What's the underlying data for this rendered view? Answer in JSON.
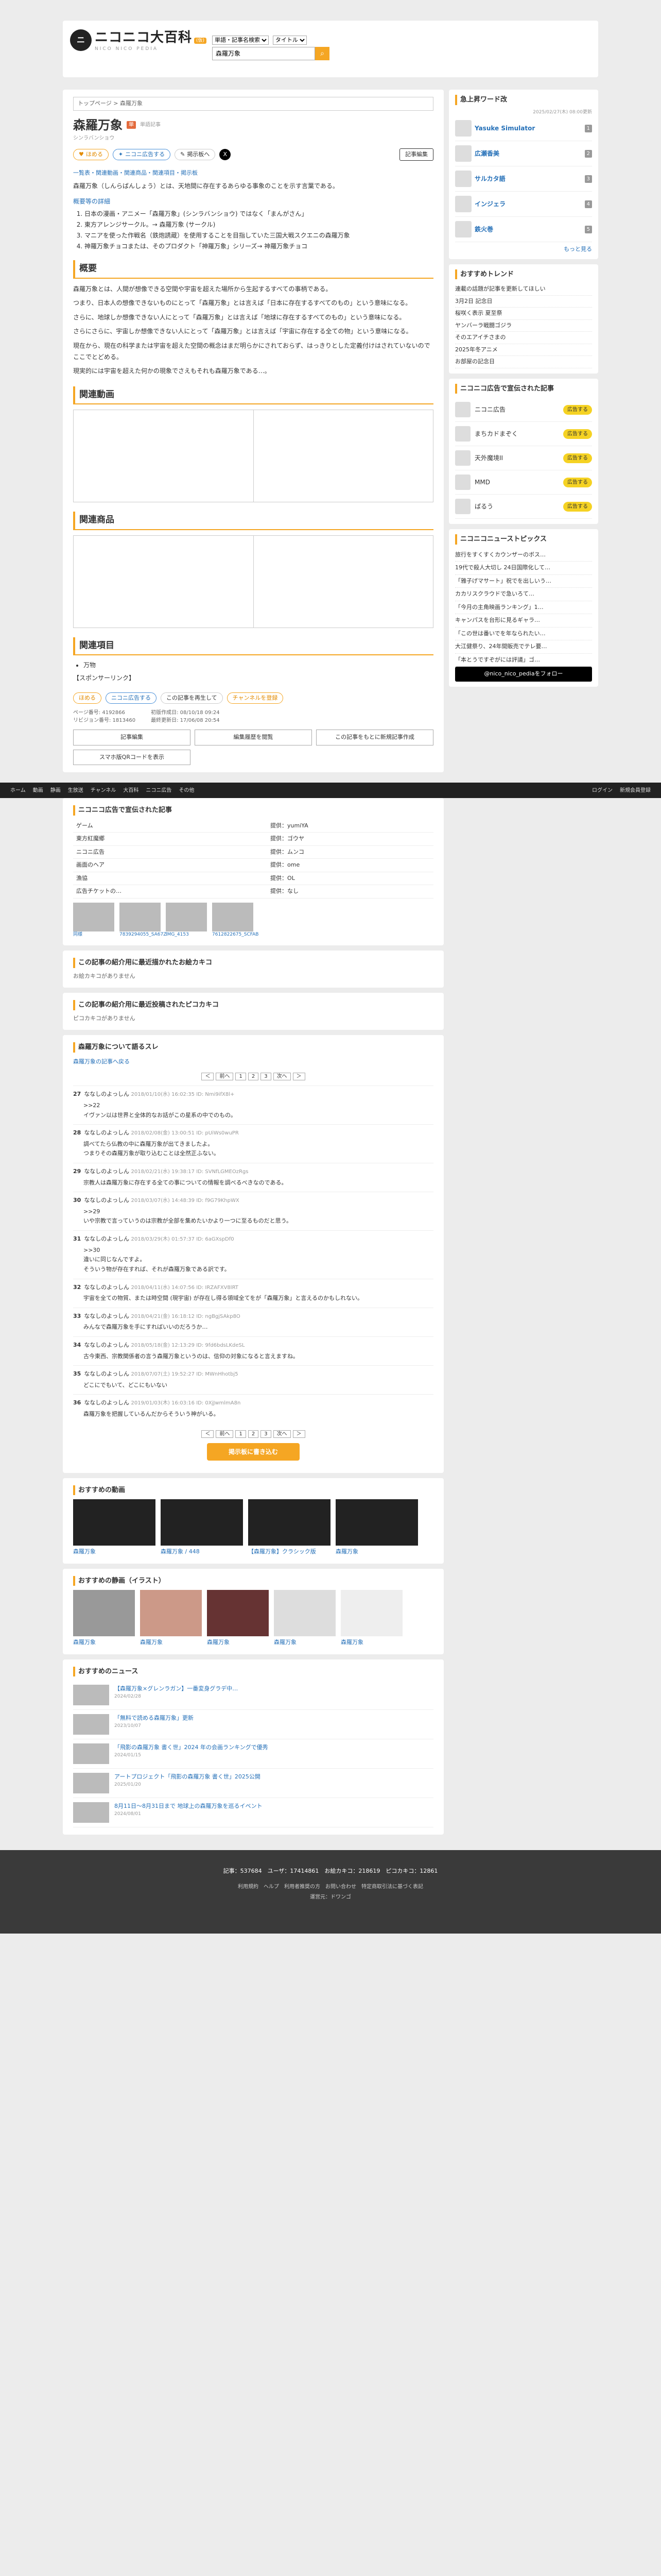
{
  "header": {
    "logo_text": "ニコニコ大百科",
    "logo_sub": "NICO NICO PEDIA",
    "logo_badge": "(仮)",
    "search_scope": "単語・記事名検索",
    "search_type": "タイトル",
    "search_value": "森羅万象"
  },
  "article": {
    "breadcrumb": "トップページ > 森羅万象",
    "title": "森羅万象",
    "badge": "単",
    "count": "単語記事",
    "reading": "シンラバンショウ",
    "like_label": "ほめる",
    "nico_label": "ニコニ広告する",
    "comment_label": "掲示板へ",
    "edit_label": "記事編集",
    "tabs": "一覧表・関連動画・関連商品・関連項目・掲示板",
    "intro": "森羅万象（しんらばんしょう）とは、天地間に存在するあらゆる事象のことを示す言葉である。",
    "toc_title": "概要等の詳細",
    "toc": [
      "日本の漫画・アニメー「森羅万象」(シンラバンショウ) ではなく「まんがさん」",
      "東方アレンジサークル。→ 森羅万象 (サークル)",
      "マニアを使った作戦名（鉄炮誘蔵）を使用することを目指していた三国大戦スクエニの森羅万象",
      "神羅万象チョコまたは、そのプロダクト「神羅万象」シリーズ→ 神羅万象チョコ"
    ],
    "s1": "概要",
    "p1": "森羅万象とは、人間が想像できる空間や宇宙を超えた場所から生起するすべての事柄である。",
    "p2": "つまり、日本人の想像できないものにとって「森羅万象」とは言えば「日本に存在するすべてのもの」という意味になる。",
    "p3": "さらに、地球しか想像できない人にとって「森羅万象」とは言えば「地球に存在するすべてのもの」という意味になる。",
    "p4": "さらにさらに、宇宙しか想像できない人にとって「森羅万象」とは言えば「宇宙に存在する全ての物」という意味になる。",
    "p5": "現在から、現在の科学または宇宙を超えた空間の概念はまだ明らかにされておらず、はっきりとした定義付けはされていないのでここでとどめる。",
    "p6": "現実的には宇宙を超えた何かの現象でさえもそれも森羅万象である…。",
    "s2": "関連動画",
    "s3": "関連商品",
    "s4": "関連項目",
    "related": [
      "万物"
    ],
    "related_link": "【スポンサーリンク】",
    "act1": "ほめる",
    "act2": "ニコニ広告する",
    "act3": "この記事を再生して",
    "act4": "チャンネルを登録",
    "meta_views": "ページ番号: 4192866",
    "meta_rev": "リビジョン番号: 1813460",
    "meta_date": "初版作成日: 08/10/18 09:24",
    "meta_last": "最終更新日: 17/06/08 20:54",
    "btn1": "記事編集",
    "btn2": "編集履歴を閲覧",
    "btn3": "この記事をもとに新規記事作成",
    "btn4": "スマホ版QRコードを表示"
  },
  "sidebar": {
    "rank_title": "急上昇ワード改",
    "rank_date": "2025/02/27(木) 08:00更新",
    "rank": [
      {
        "name": "Yasuke Simulator",
        "n": "1"
      },
      {
        "name": "広瀬香美",
        "n": "2"
      },
      {
        "name": "サルカタ語",
        "n": "3"
      },
      {
        "name": "インジェラ",
        "n": "4"
      },
      {
        "name": "鉄火巻",
        "n": "5"
      }
    ],
    "rank_more": "もっと見る",
    "trend_title": "おすすめトレンド",
    "trends": [
      "連載の話題が記事を更新してほしい",
      "3月2日 記念日",
      "桜咲く表示 夏至祭",
      "ヤンバーラ戦闘ゴジラ",
      "そのエアイチさまの",
      "2025年冬アニメ",
      "お部屋の記念日"
    ],
    "ad_title": "ニコニコ広告で宣伝された記事",
    "ads": [
      {
        "name": "ニコニ広告",
        "btn": "広告する"
      },
      {
        "name": "まちカドまぞく",
        "btn": "広告する"
      },
      {
        "name": "天外魔境II",
        "btn": "広告する"
      },
      {
        "name": "MMD",
        "btn": "広告する"
      },
      {
        "name": "ぱるう",
        "btn": "広告する"
      }
    ],
    "news_title": "ニコニコニューストピックス",
    "news": [
      "旅行をすくすくカウンザーのボス…",
      "19代で殺人大切し 24日国際化して…",
      "「雅子げマサート」祝でを出しいう…",
      "カカリスクラウドで急いろて…",
      "「今月の主角映画ランキング」1…",
      "キャンパスを台形に見るギャラ…",
      "「この世は番いでを年なられたい…",
      "大江健祭り、24年間販売でテレ要…",
      "「本とうですぞがには評議」ゴ…"
    ],
    "follow_label": "@nico_nico_pediaをフォロー"
  },
  "globalbar": [
    "ホーム",
    "動画",
    "静画",
    "生放送",
    "チャンネル",
    "大百科",
    "ニコニ広告",
    "その他",
    "ログイン",
    "新規会員登録"
  ],
  "lower": {
    "share_title": "ニコニコ広告で宣伝された記事",
    "ads_rows": [
      {
        "name": "ゲーム",
        "by": "提供：yumiYA"
      },
      {
        "name": "東方紅魔郷",
        "by": "提供：ゴウヤ"
      },
      {
        "name": "ニコニ広告",
        "by": "提供：ムンコ"
      },
      {
        "name": "画面のヘア",
        "by": "提供：ome"
      },
      {
        "name": "漁協",
        "by": "提供：OL"
      },
      {
        "name": "広告チケットの…",
        "by": "提供：なし"
      }
    ],
    "thumbs": [
      "同様",
      "7839294055_SA67Z",
      "IMG_4153",
      "7612822675_SCFAB"
    ],
    "pics_title": "この記事の紹介用に最近描かれたお絵カキコ",
    "pics_none": "お絵カキコがありません",
    "pico_title": "この記事の紹介用に最近投稿されたピコカキコ",
    "pico_none": "ピコカキコがありません",
    "bbs_title": "森羅万象について語るスレ",
    "bbs_link": "森羅万象の記事へ戻る",
    "res": [
      {
        "n": "27",
        "name": "ななしのよっしん",
        "dt": "2018/01/10(水) 16:02:35 ID: Nmi9ifX8l+",
        "body": ">>22\nイヴァン以は世界と全体的なお話がこの星系の中でのもの。"
      },
      {
        "n": "28",
        "name": "ななしのよっしん",
        "dt": "2018/02/08(金) 13:00:51 ID: pUiWs0wuPR",
        "body": "調べてたら仏教の中に森羅万象が出てきましたよ。\nつまりその森羅万象が取り込むことは全然正ふない。"
      },
      {
        "n": "29",
        "name": "ななしのよっしん",
        "dt": "2018/02/21(水) 19:38:17 ID: SVNfLGMEOzRgs",
        "body": "宗教人は森羅万象に存在する全ての事についての情報を調べるべきなのである。"
      },
      {
        "n": "30",
        "name": "ななしのよっしん",
        "dt": "2018/03/07(水) 14:48:39 ID: f9G79KhpWX",
        "body": ">>29\nいや宗教で言っていうのは宗教が全部を集めたいかより一つに至るものだと思う。"
      },
      {
        "n": "31",
        "name": "ななしのよっしん",
        "dt": "2018/03/29(木) 01:57:37 ID: 6aGXspDf0",
        "body": ">>30\n違いに同じなんですよ。\nそういう物が存在すれば、それが森羅万象である訳です。"
      },
      {
        "n": "32",
        "name": "ななしのよっしん",
        "dt": "2018/04/11(水) 14:07:56 ID: IRZAFXV8lRT",
        "body": "宇宙を全ての物質、または時空間 (現宇宙) が存在し得る領域全てをが「森羅万象」と言えるのかもしれない。"
      },
      {
        "n": "33",
        "name": "ななしのよっしん",
        "dt": "2018/04/21(金) 16:18:12 ID: ngBgjSAkp8O",
        "body": "みんなで森羅万象を手にすればいいのだろうか…"
      },
      {
        "n": "34",
        "name": "ななしのよっしん",
        "dt": "2018/05/18(金) 12:13:29 ID: 9fd6bdsLKdeSL",
        "body": "古今東西、宗教関係者の言う森羅万象というのは、信仰の対象になると言えますね。"
      },
      {
        "n": "35",
        "name": "ななしのよっしん",
        "dt": "2018/07/07(土) 19:52:27 ID: MWnHhotbj5",
        "body": "どこにでもいて、どこにもいない"
      },
      {
        "n": "36",
        "name": "ななしのよっしん",
        "dt": "2019/01/03(木) 16:03:16 ID: 0XjJwmlmA8n",
        "body": "森羅万象を把握しているんだからそういう神がいる。"
      }
    ],
    "pager": [
      "＜",
      "前へ",
      "1",
      "2",
      "3",
      "次へ",
      "＞"
    ],
    "post_btn": "掲示板に書き込む",
    "vid_title": "おすすめの動画",
    "vids": [
      "森羅万象",
      "森羅万象 / 448",
      "【森羅万象】クラシック版",
      "森羅万象"
    ],
    "ill_title": "おすすめの静画（イラスト）",
    "ills": [
      "森羅万象",
      "森羅万象",
      "森羅万象",
      "森羅万象",
      "森羅万象"
    ],
    "news_title": "おすすめのニュース",
    "news": [
      {
        "t": "【森羅万象×グレンラガン】一番変身グラデ中…",
        "d": "2024/02/28"
      },
      {
        "t": "「無料で読める森羅万象」更新",
        "d": "2023/10/07"
      },
      {
        "t": "「飛影の森羅万象 書く世」2024 年の会画ランキングで優秀",
        "d": "2024/01/15"
      },
      {
        "t": "アートプロジェクト「飛影の森羅万象 書く世」2025公開",
        "d": "2025/01/20"
      },
      {
        "t": "8月11日〜8月31日まで 地球上の森羅万象を巡るイベント",
        "d": "2024/08/01"
      }
    ]
  },
  "footer": {
    "stats": "記事：537684　ユーザ：17414861　お絵カキコ：218619　ピコカキコ：12861",
    "links": "利用規約　ヘルプ　利用者推奨の方　お問い合わせ　特定商取引法に基づく表記",
    "copyright": "運営元：ドワンゴ"
  }
}
